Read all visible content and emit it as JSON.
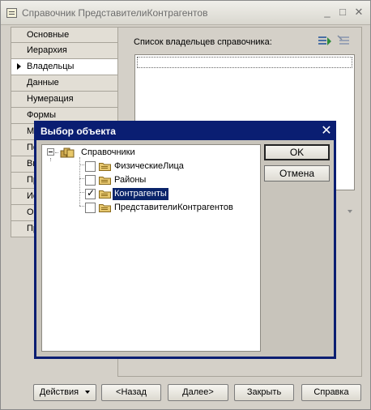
{
  "window": {
    "title": "Справочник ПредставителиКонтрагентов",
    "minimize": "_",
    "maximize": "□",
    "close": "✕"
  },
  "tabs": [
    {
      "label": "Основные",
      "active": false
    },
    {
      "label": "Иерархия",
      "active": false
    },
    {
      "label": "Владельцы",
      "active": true
    },
    {
      "label": "Данные",
      "active": false
    },
    {
      "label": "Нумерация",
      "active": false
    },
    {
      "label": "Формы",
      "active": false
    },
    {
      "label": "Ма",
      "active": false
    },
    {
      "label": "По",
      "active": false
    },
    {
      "label": "Вв",
      "active": false
    },
    {
      "label": "Пр",
      "active": false
    },
    {
      "label": "Ис",
      "active": false
    },
    {
      "label": "Об",
      "active": false
    },
    {
      "label": "Пр",
      "active": false
    }
  ],
  "owners_panel": {
    "label": "Список владельцев справочника:",
    "edit_icon": "edit-list-icon",
    "disabled_icon": "list-settings-icon"
  },
  "bottom_buttons": {
    "actions": "Действия",
    "back": "<Назад",
    "next": "Далее>",
    "close": "Закрыть",
    "help": "Справка"
  },
  "dialog": {
    "title": "Выбор объекта",
    "close": "✕",
    "ok": "OK",
    "cancel": "Отмена",
    "tree": {
      "root": "Справочники",
      "items": [
        {
          "label": "ФизическиеЛица",
          "checked": false,
          "selected": false
        },
        {
          "label": "Районы",
          "checked": false,
          "selected": false
        },
        {
          "label": "Контрагенты",
          "checked": true,
          "selected": true
        },
        {
          "label": "ПредставителиКонтрагентов",
          "checked": false,
          "selected": false
        }
      ]
    }
  },
  "colors": {
    "dialog_title_bg": "#0a1e72",
    "selection_bg": "#0a246a",
    "form_bg": "#d4d0c8"
  }
}
